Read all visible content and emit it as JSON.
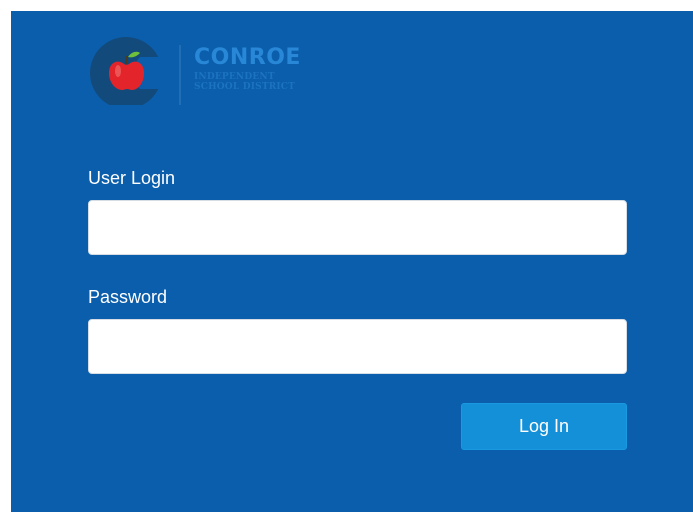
{
  "logo": {
    "title": "CONROE",
    "subtitle_line1": "INDEPENDENT",
    "subtitle_line2": "SCHOOL DISTRICT"
  },
  "form": {
    "user_label": "User Login",
    "user_value": "",
    "password_label": "Password",
    "password_value": "",
    "submit_label": "Log In"
  },
  "colors": {
    "panel_background": "#0b5eab",
    "button_background": "#1490d8",
    "logo_circle": "#134a7c",
    "apple_red": "#e3252b",
    "leaf_green": "#6fbf3b",
    "logo_text": "#2887d6"
  },
  "icons": {
    "logo_emblem": "apple-c-emblem"
  }
}
